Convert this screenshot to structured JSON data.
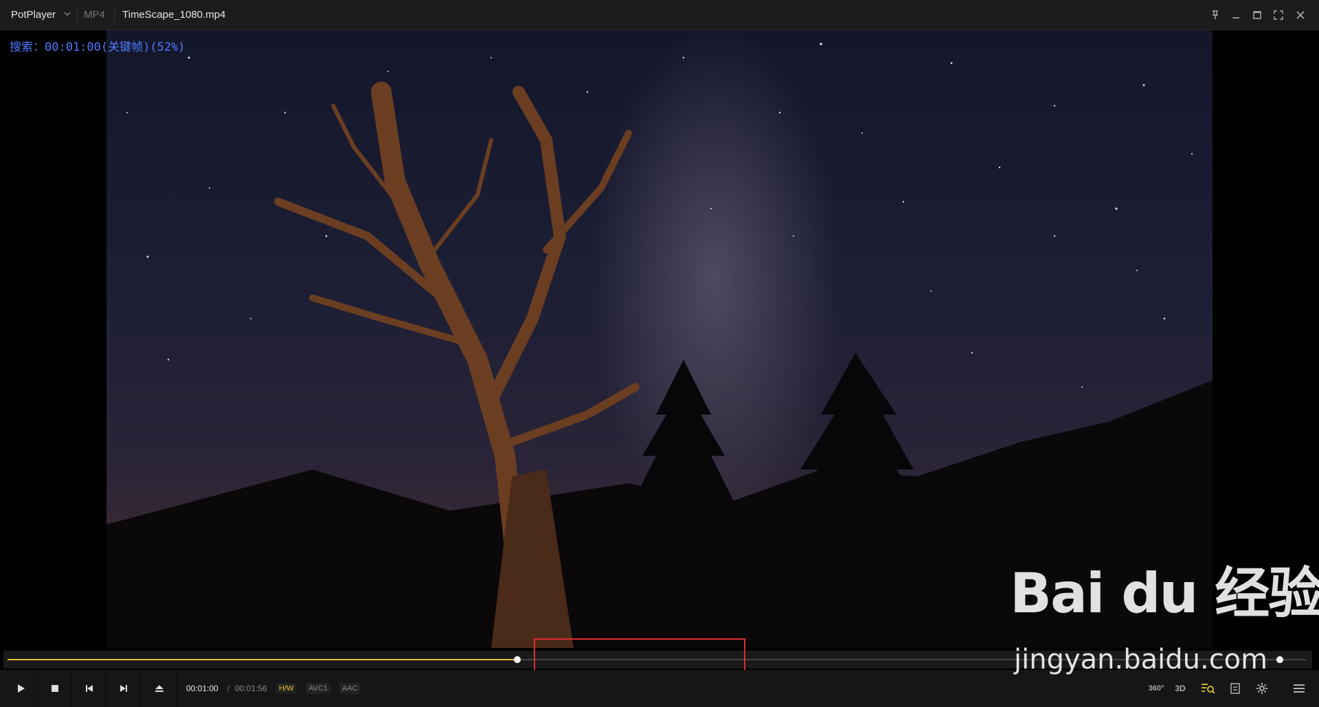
{
  "titlebar": {
    "app_name": "PotPlayer",
    "format": "MP4",
    "filename": "TimeScape_1080.mp4"
  },
  "osd": {
    "text": "搜索：00:01:00(关键帧)(52%)"
  },
  "playback": {
    "current_time": "00:01:00",
    "separator": "/",
    "total_time": "00:01:56",
    "progress_fraction": 0.52
  },
  "badges": {
    "hw": "H/W",
    "video_codec": "AVC1",
    "audio_codec": "AAC"
  },
  "right_controls": {
    "vr360": "360°",
    "three_d": "3D"
  },
  "watermark": {
    "logo": "Bai du 经验",
    "url": "jingyan.baidu.com"
  },
  "colors": {
    "accent": "#e7c22e",
    "osd": "#4d7dff",
    "highlight": "#e02d2d"
  }
}
